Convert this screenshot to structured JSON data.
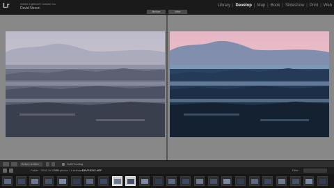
{
  "app": {
    "logo": "Lr",
    "brand_line1": "Adobe Lightroom Classic CC",
    "brand_line2": "David Nexon"
  },
  "modules": [
    {
      "label": "Library",
      "active": false
    },
    {
      "label": "Develop",
      "active": true
    },
    {
      "label": "Map",
      "active": false
    },
    {
      "label": "Book",
      "active": false
    },
    {
      "label": "Slideshow",
      "active": false
    },
    {
      "label": "Print",
      "active": false
    },
    {
      "label": "Web",
      "active": false
    }
  ],
  "compare": {
    "before_label": "Before",
    "after_label": "After"
  },
  "toolbar": {
    "view_mode": "Before & After",
    "soft_proofing": "Soft Proofing"
  },
  "filmstrip_bar": {
    "folder": "Folder : 2018 Jul 2016",
    "count": "148 photos / 1 selected / ",
    "filename": "DAVE8310.NEF",
    "filter_label": "Filter :",
    "thumb_count": 24
  },
  "colors": {
    "accent_active": "#f0f0f0",
    "selected_thumb": "#cfcfcf"
  }
}
